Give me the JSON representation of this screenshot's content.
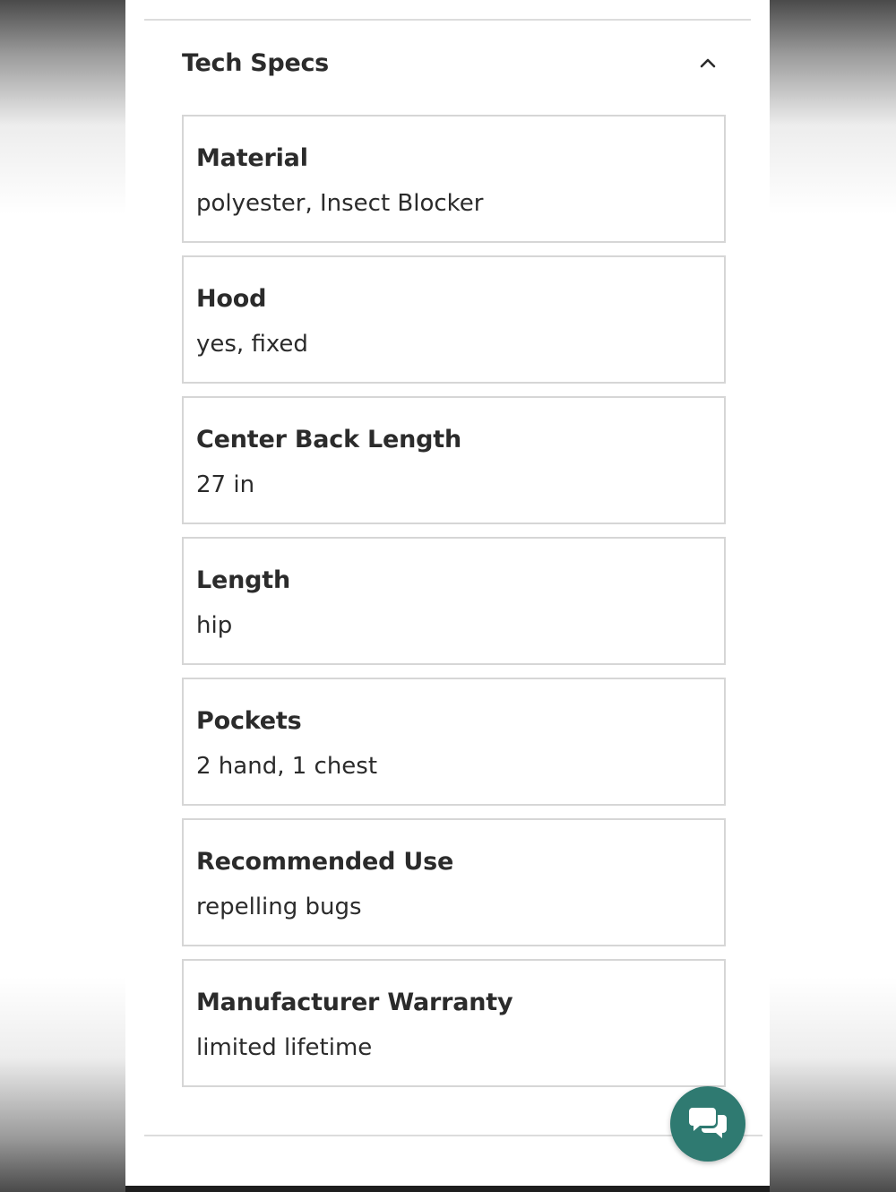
{
  "tech_specs": {
    "title": "Tech Specs",
    "expanded": true,
    "toggle_icon": "chevron-up-icon",
    "items": [
      {
        "label": "Material",
        "value": "polyester, Insect Blocker"
      },
      {
        "label": "Hood",
        "value": "yes, fixed"
      },
      {
        "label": "Center Back Length",
        "value": "27 in"
      },
      {
        "label": "Length",
        "value": "hip"
      },
      {
        "label": "Pockets",
        "value": "2 hand, 1 chest"
      },
      {
        "label": "Recommended Use",
        "value": "repelling bugs"
      },
      {
        "label": "Manufacturer Warranty",
        "value": "limited lifetime"
      }
    ]
  },
  "chat": {
    "icon": "chat-bubbles-icon",
    "color": "#2f7a71"
  },
  "colors": {
    "text": "#2b2b2b",
    "border": "#d6d6d6",
    "chat_accent": "#2f7a71"
  }
}
